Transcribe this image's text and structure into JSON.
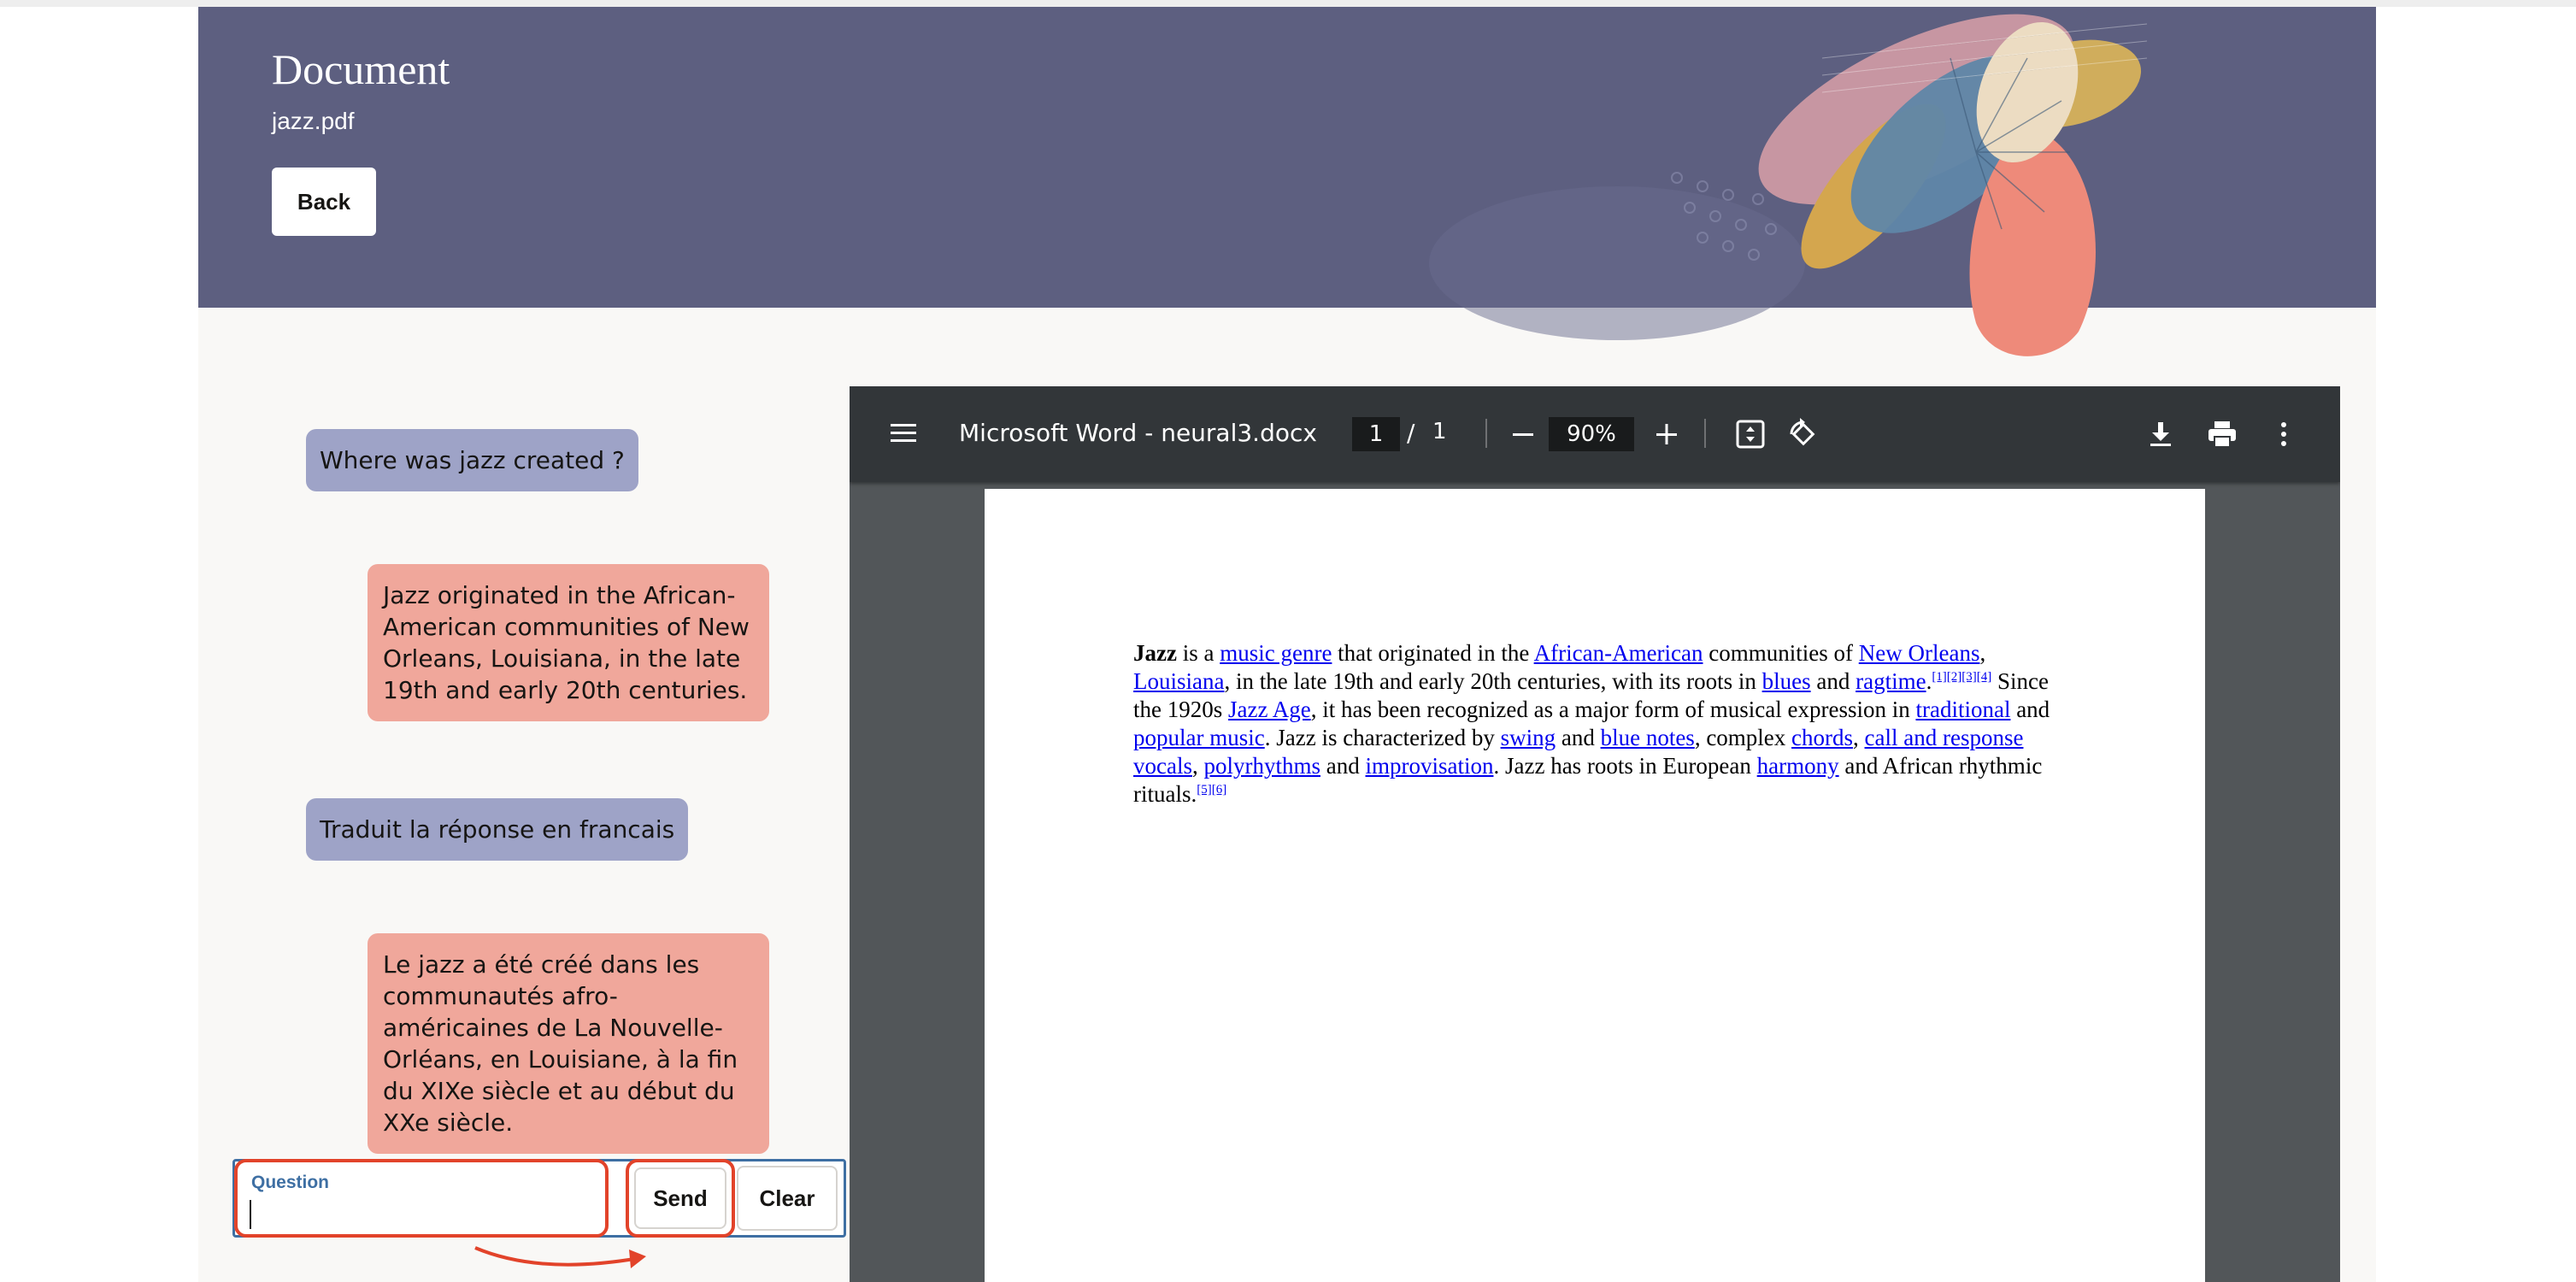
{
  "header": {
    "title": "Document",
    "filename": "jazz.pdf",
    "back_label": "Back"
  },
  "chat": {
    "messages": [
      {
        "role": "user",
        "text": "Where was jazz created ?"
      },
      {
        "role": "assistant",
        "text": "Jazz originated in the African-American communities of New Orleans, Louisiana, in the late 19th and early 20th centuries."
      },
      {
        "role": "user",
        "text": "Traduit la réponse en francais"
      },
      {
        "role": "assistant",
        "text": "Le jazz a été créé dans les communautés afro-américaines de La Nouvelle-Orléans, en Louisiane, à la fin du XIXe siècle et au début du XXe siècle."
      }
    ]
  },
  "question": {
    "label": "Question",
    "value": "",
    "send_label": "Send",
    "clear_label": "Clear"
  },
  "pdf": {
    "title": "Microsoft Word - neural3.docx",
    "page_current": "1",
    "page_separator": "/",
    "page_total": "1",
    "zoom": "90%",
    "body": {
      "t_bold": "Jazz",
      "t1": " is a ",
      "l1": "music genre",
      "t2": " that originated in the ",
      "l2": "African-American",
      "t3": " communities of ",
      "l3": "New Orleans",
      "t4": ", ",
      "l4": "Louisiana",
      "t5": ", in the late 19th and early 20th centuries, with its roots in ",
      "l5": "blues",
      "t6": " and ",
      "l6": "ragtime",
      "t7": ".",
      "s1": "[1][2][3][4]",
      "t8": " Since the 1920s ",
      "l7": "Jazz Age",
      "t9": ", it has been recognized as a major form of musical expression in ",
      "l8": "traditional",
      "t10": " and ",
      "l9": "popular music",
      "t11": ". Jazz is characterized by ",
      "l10": "swing",
      "t12": " and ",
      "l11": "blue notes",
      "t13": ", complex ",
      "l12": "chords",
      "t14": ", ",
      "l13": "call and response vocals",
      "t15": ", ",
      "l14": "polyrhythms",
      "t16": " and ",
      "l15": "improvisation",
      "t17": ". Jazz has roots in European ",
      "l16": "harmony",
      "t18": " and African rhythmic rituals.",
      "s2": "[5][6]"
    }
  },
  "colors": {
    "header_bg": "#5d5f80",
    "user_bubble": "#9ea3c7",
    "assistant_bubble": "#f0a79b",
    "annotation": "#e2432a",
    "link": "#0000ee",
    "viewer_toolbar": "#323639",
    "viewer_bg": "#525659"
  },
  "icons": [
    "menu-icon",
    "zoom-out-icon",
    "zoom-in-icon",
    "fit-page-icon",
    "rotate-icon",
    "download-icon",
    "print-icon",
    "more-vert-icon"
  ]
}
